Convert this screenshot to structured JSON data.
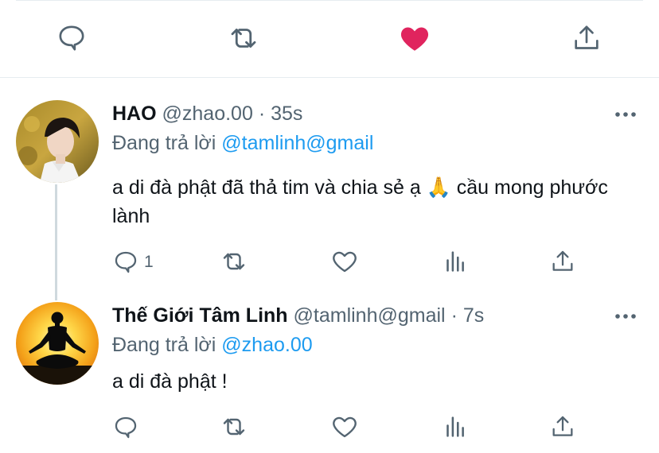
{
  "colors": {
    "like_active": "#e0245e",
    "link": "#1d9bf0",
    "secondary": "#536471",
    "primary_text": "#0f1419",
    "divider": "#e6ecf0"
  },
  "top_actions": {
    "icons": [
      "reply-icon",
      "retweet-icon",
      "heart-filled-icon",
      "share-icon"
    ]
  },
  "tweets": [
    {
      "name": "HAO",
      "handle": "@zhao.00",
      "dot": "·",
      "time": "35s",
      "reply_prefix": "Đang trả lời",
      "reply_to": "@tamlinh@gmail",
      "text": "a di đà phật đã thả tim và chia sẻ ạ 🙏  cầu mong phước lành",
      "reply_count": "1",
      "more_icon": "more-icon"
    },
    {
      "name": "Thế Giới Tâm Linh",
      "handle": "@tamlinh@gmail",
      "dot": "·",
      "time": "7s",
      "reply_prefix": "Đang trả lời",
      "reply_to": "@zhao.00",
      "text": "a di đà phật !",
      "reply_count": "",
      "more_icon": "more-icon"
    }
  ]
}
